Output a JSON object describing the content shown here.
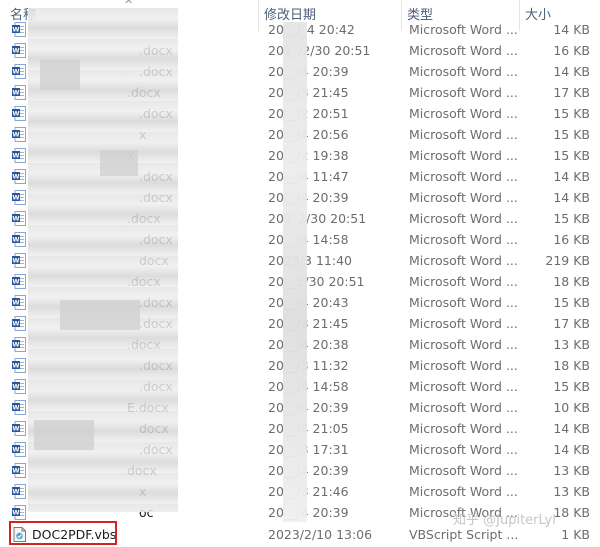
{
  "columns": {
    "name": "名称",
    "date": "修改日期",
    "type": "类型",
    "size": "大小"
  },
  "sort_indicator": "^",
  "rows": [
    {
      "name_tail": "",
      "date": "20__/_4 20:42",
      "type": "Microsoft Word ...",
      "size": "14 KB"
    },
    {
      "name_tail": ".docx",
      "date": "202_/2/30 20:51",
      "type": "Microsoft Word ...",
      "size": "16 KB"
    },
    {
      "name_tail": ".docx",
      "date": "20__/4 20:39",
      "type": "Microsoft Word ...",
      "size": "14 KB"
    },
    {
      "name_tail": ".docx",
      "date": "20__/3 21:45",
      "type": "Microsoft Word ...",
      "size": "17 KB"
    },
    {
      "name_tail": ".docx",
      "date": "20__/2 20:51",
      "type": "Microsoft Word ...",
      "size": "15 KB"
    },
    {
      "name_tail": "x",
      "date": "20__/4 20:56",
      "type": "Microsoft Word ...",
      "size": "15 KB"
    },
    {
      "name_tail": "x",
      "date": "20__/2 19:38",
      "type": "Microsoft Word ...",
      "size": "15 KB"
    },
    {
      "name_tail": ".docx",
      "date": "20__/4 11:47",
      "type": "Microsoft Word ...",
      "size": "14 KB"
    },
    {
      "name_tail": ".docx",
      "date": "20__/4 20:39",
      "type": "Microsoft Word ...",
      "size": "14 KB"
    },
    {
      "name_tail": ".docx",
      "date": "202_2/30 20:51",
      "type": "Microsoft Word ...",
      "size": "15 KB"
    },
    {
      "name_tail": ".docx",
      "date": "20__/4 14:58",
      "type": "Microsoft Word ...",
      "size": "16 KB"
    },
    {
      "name_tail": "docx",
      "date": "2023/3 11:40",
      "type": "Microsoft Word ...",
      "size": "219 KB"
    },
    {
      "name_tail": ".docx",
      "date": "20__2/30 20:51",
      "type": "Microsoft Word ...",
      "size": "18 KB"
    },
    {
      "name_tail": ".docx",
      "date": "20__/4 20:43",
      "type": "Microsoft Word ...",
      "size": "15 KB"
    },
    {
      "name_tail": ".docx",
      "date": "20__/3 21:45",
      "type": "Microsoft Word ...",
      "size": "17 KB"
    },
    {
      "name_tail": ".docx",
      "date": "20__/4 20:38",
      "type": "Microsoft Word ...",
      "size": "13 KB"
    },
    {
      "name_tail": ".docx",
      "date": "20__/3 11:32",
      "type": "Microsoft Word ...",
      "size": "18 KB"
    },
    {
      "name_tail": ".docx",
      "date": "20__/4 14:58",
      "type": "Microsoft Word ...",
      "size": "15 KB"
    },
    {
      "name_tail": "E.docx",
      "date": "20__/4 20:39",
      "type": "Microsoft Word ...",
      "size": "10 KB"
    },
    {
      "name_tail": "docx",
      "date": "20__/4 21:05",
      "type": "Microsoft Word ...",
      "size": "14 KB"
    },
    {
      "name_tail": ".docx",
      "date": "20__/3 17:31",
      "type": "Microsoft Word ...",
      "size": "14 KB"
    },
    {
      "name_tail": "docx",
      "date": "20__/4 20:39",
      "type": "Microsoft Word ...",
      "size": "13 KB"
    },
    {
      "name_tail": "x",
      "date": "20__/3 21:46",
      "type": "Microsoft Word ...",
      "size": "13 KB"
    },
    {
      "name_tail": "oc",
      "date": "20__/4 20:39",
      "type": "Microsoft Word ...",
      "size": "18 KB"
    }
  ],
  "script_file": {
    "name": "DOC2PDF.vbs",
    "date": "2023/2/10 13:06",
    "type": "VBScript Script ...",
    "size": "1 KB"
  },
  "watermark": "知乎 @JupiterLyl",
  "colors": {
    "header_text": "#4c607a",
    "highlight": "#d5231f",
    "word_blue": "#2b579a"
  }
}
